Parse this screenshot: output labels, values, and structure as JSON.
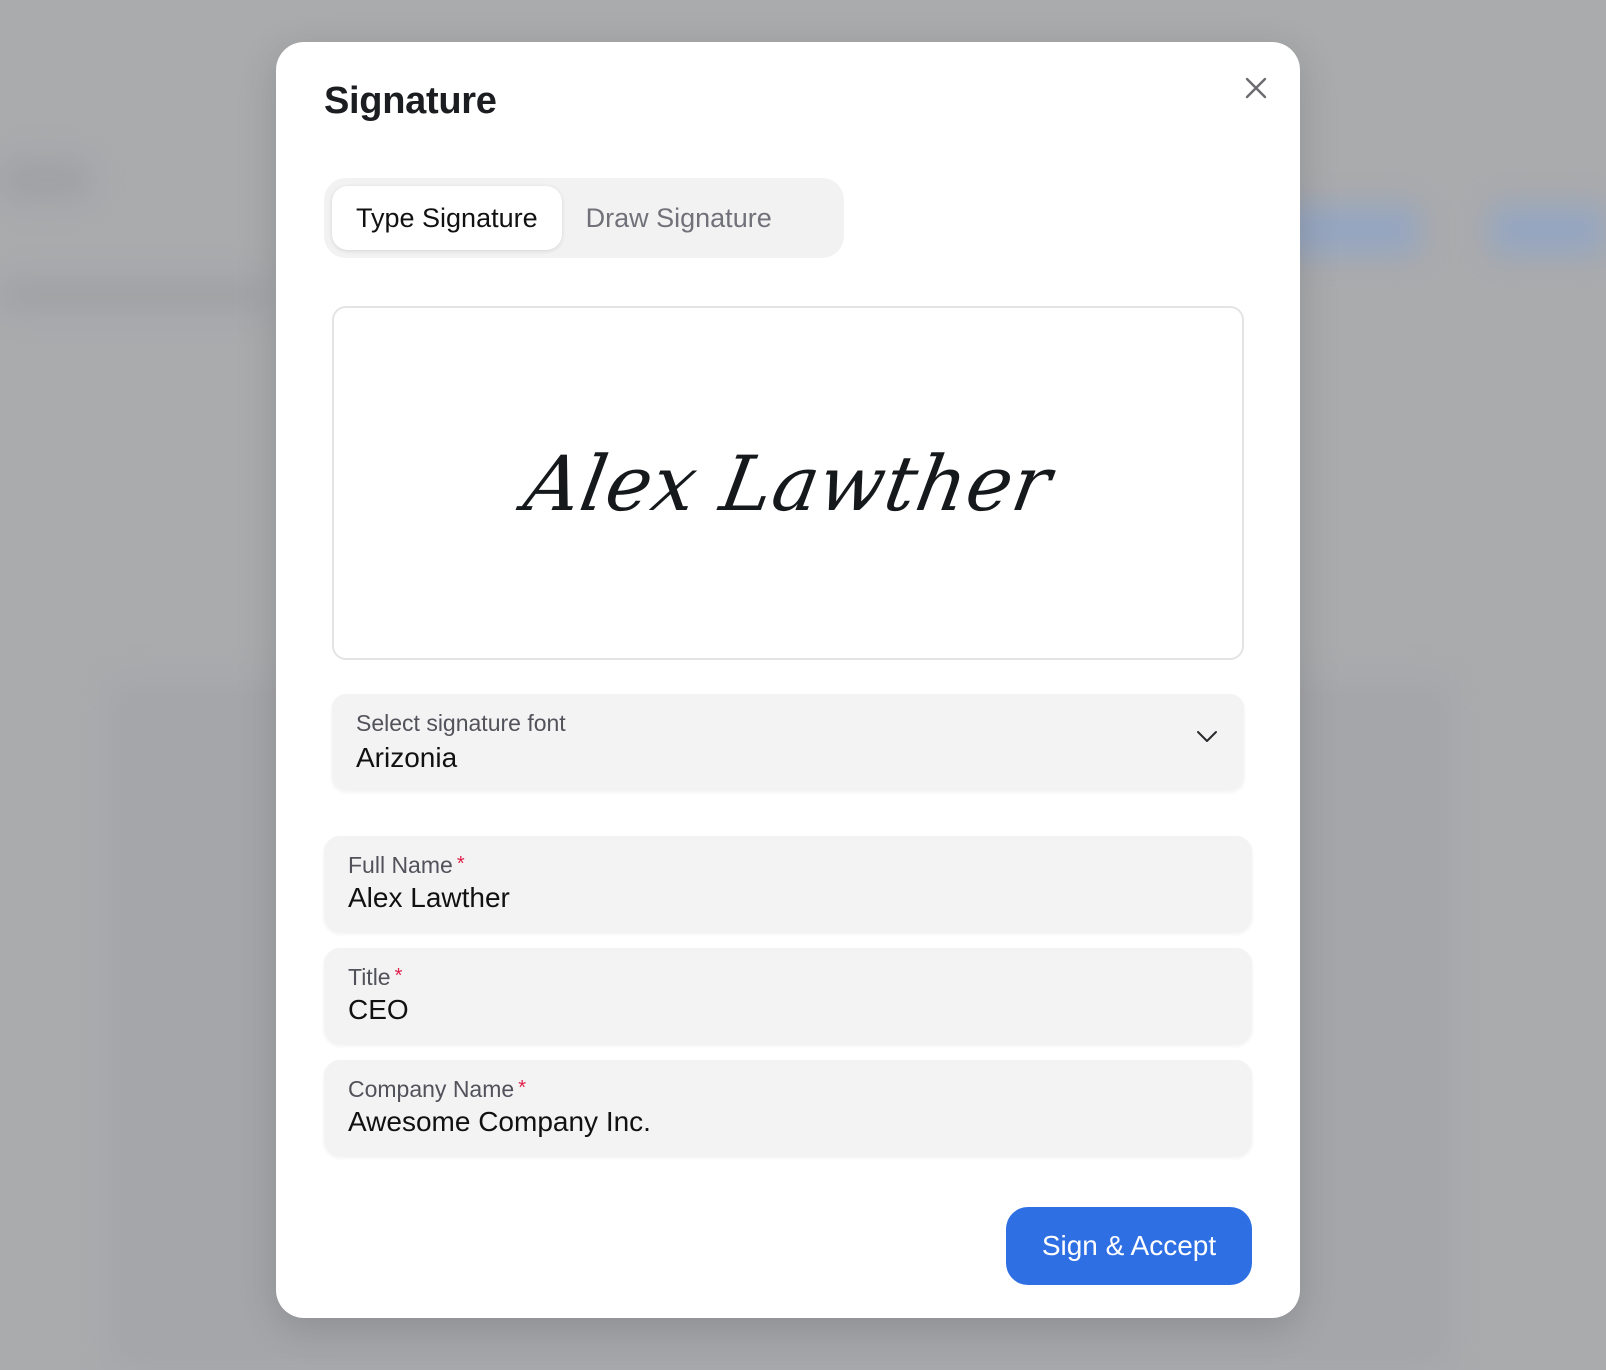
{
  "modal": {
    "title": "Signature",
    "close_icon": "close-icon",
    "tabs": [
      {
        "label": "Type Signature",
        "active": true
      },
      {
        "label": "Draw Signature",
        "active": false
      }
    ],
    "signature_preview": {
      "text": "Alex Lawther",
      "font_name": "Arizonia"
    },
    "font_select": {
      "label": "Select signature font",
      "value": "Arizonia",
      "icon": "chevron-down-icon"
    },
    "fields": [
      {
        "label": "Full Name",
        "required_marker": "*",
        "value": "Alex Lawther"
      },
      {
        "label": "Title",
        "required_marker": "*",
        "value": "CEO"
      },
      {
        "label": "Company Name",
        "required_marker": "*",
        "value": "Awesome Company Inc."
      }
    ],
    "submit_label": "Sign & Accept"
  },
  "colors": {
    "primary": "#2f6fe4",
    "required": "#e11d48",
    "field_bg": "#f3f3f4"
  }
}
